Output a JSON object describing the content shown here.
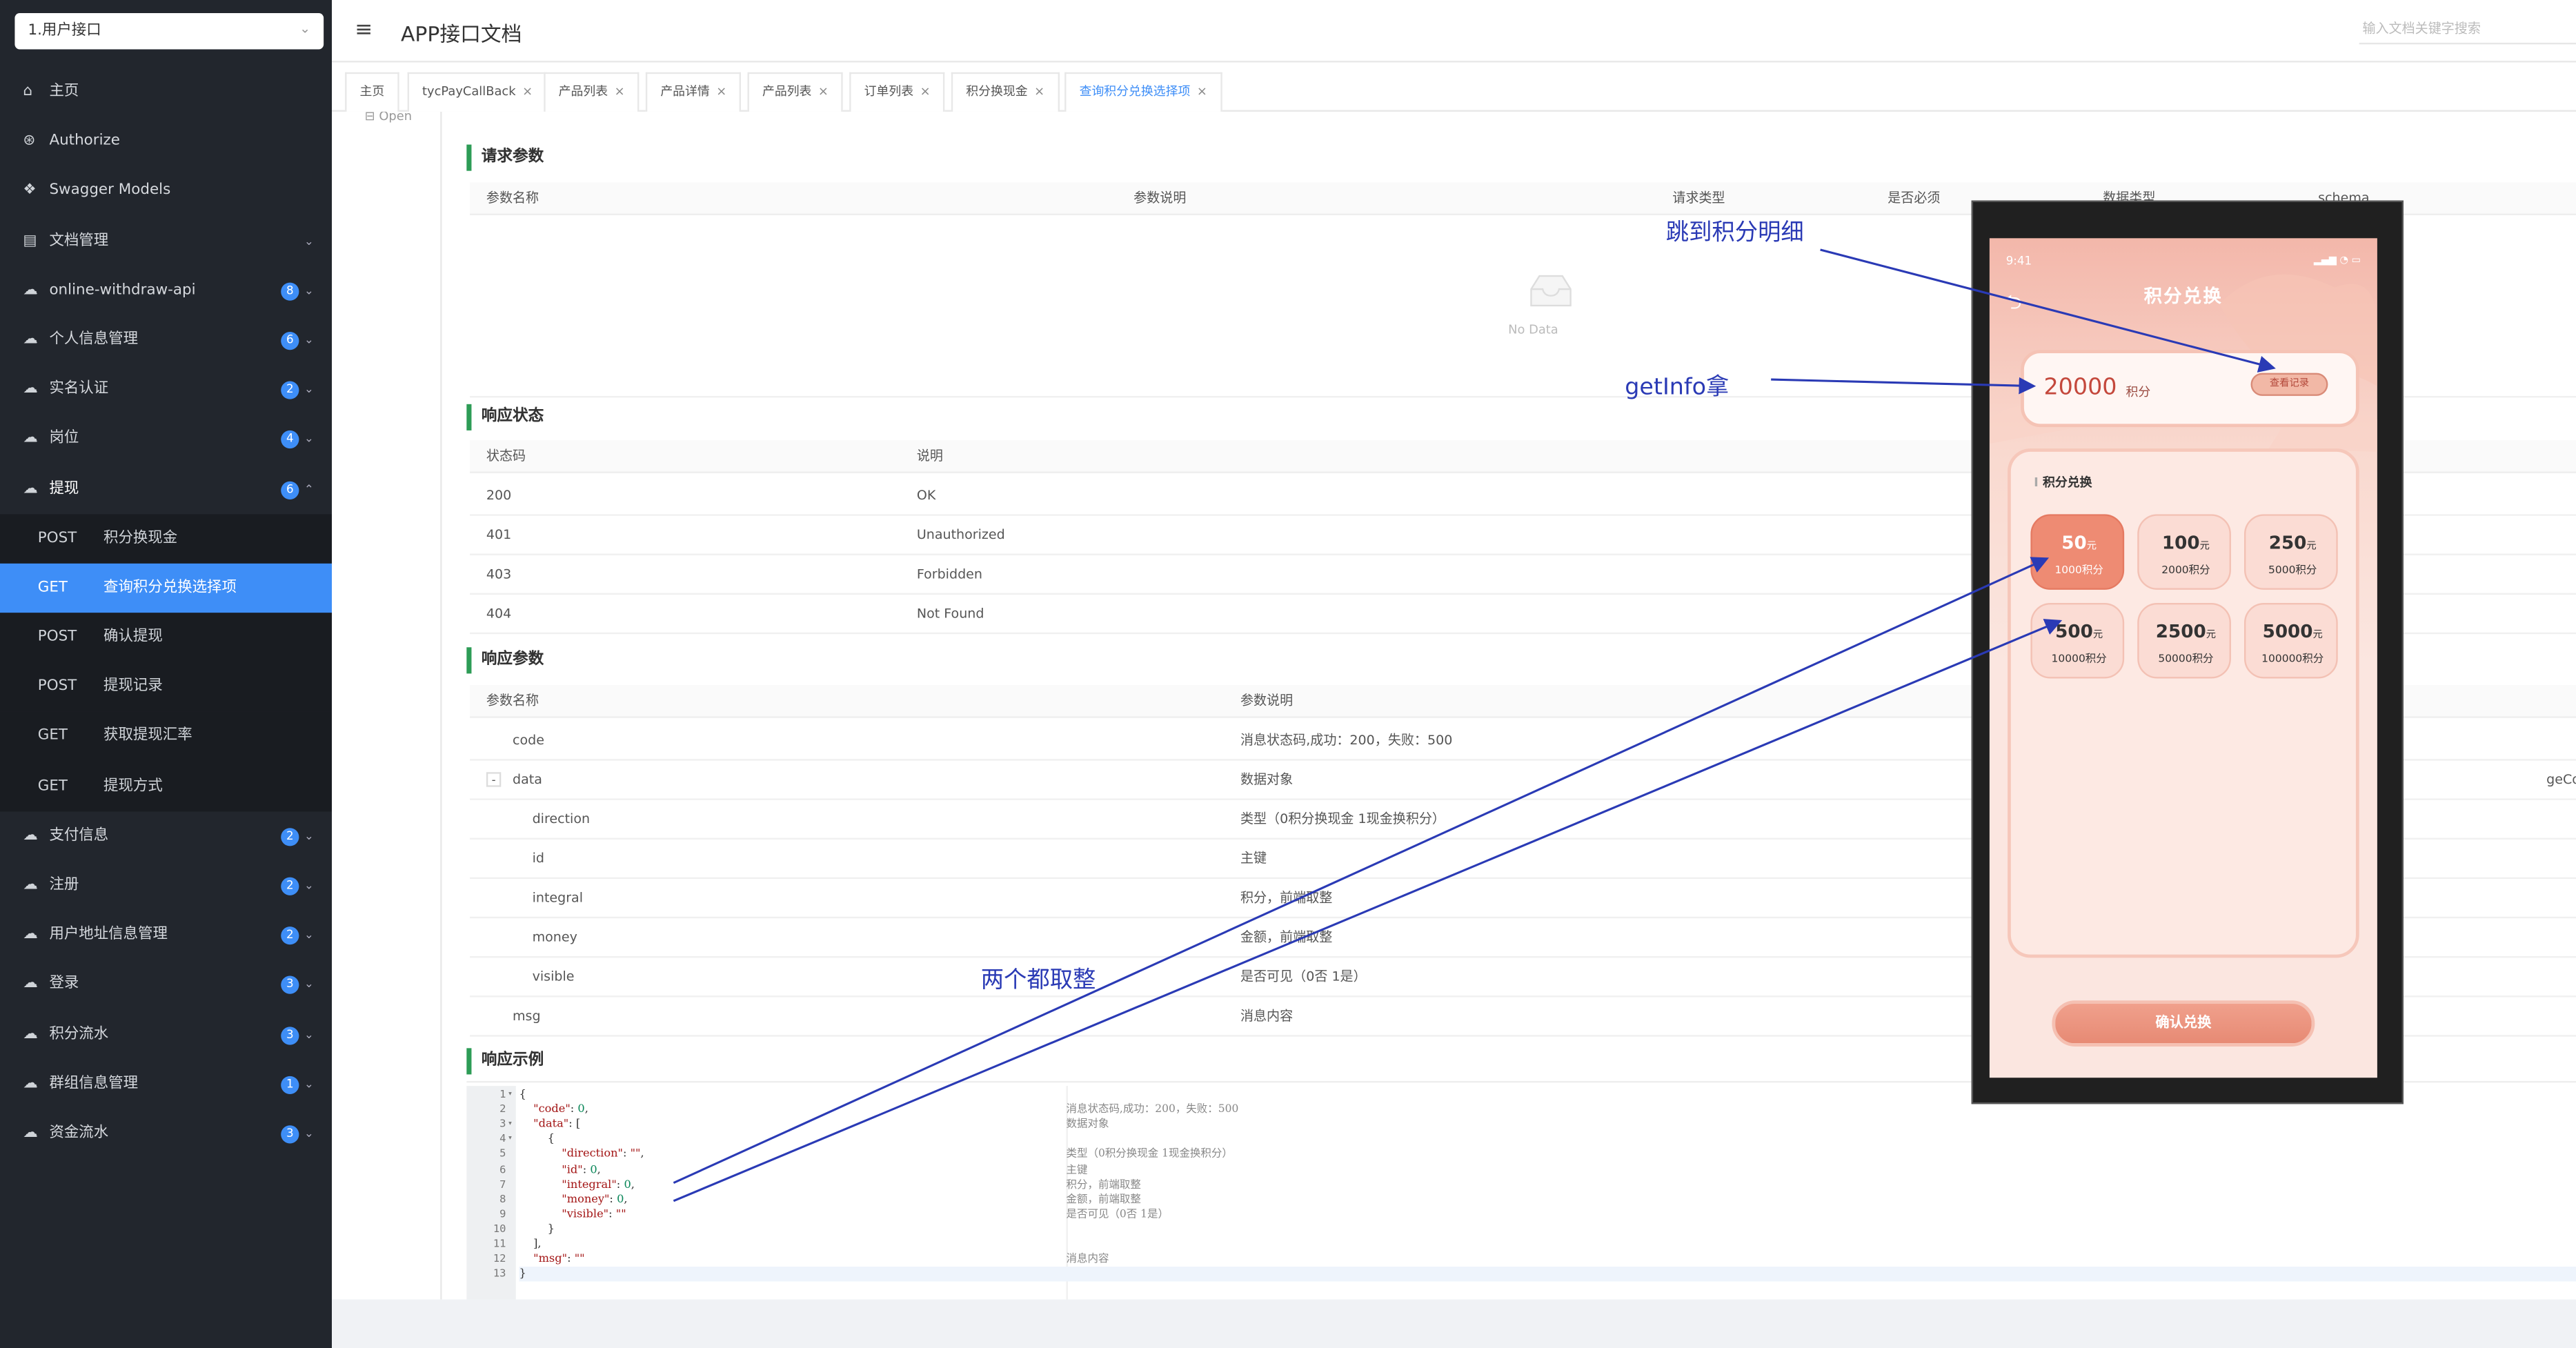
{
  "sidebar": {
    "group_select": "1.用户接口",
    "items": [
      {
        "icon": "home-icon",
        "glyph": "⌂",
        "label": "主页"
      },
      {
        "icon": "lock-icon",
        "glyph": "⊛",
        "label": "Authorize"
      },
      {
        "icon": "models-icon",
        "glyph": "❖",
        "label": "Swagger Models"
      },
      {
        "icon": "document-icon",
        "glyph": "▤",
        "label": "文档管理",
        "arrow": "⌄"
      },
      {
        "icon": "cloud-icon",
        "glyph": "☁",
        "label": "online-withdraw-api",
        "badge": "8",
        "arrow": "⌄"
      },
      {
        "icon": "cloud-icon",
        "glyph": "☁",
        "label": "个人信息管理",
        "badge": "6",
        "arrow": "⌄"
      },
      {
        "icon": "cloud-icon",
        "glyph": "☁",
        "label": "实名认证",
        "badge": "2",
        "arrow": "⌄"
      },
      {
        "icon": "cloud-icon",
        "glyph": "☁",
        "label": "岗位",
        "badge": "4",
        "arrow": "⌄"
      },
      {
        "icon": "cloud-icon",
        "glyph": "☁",
        "label": "提现",
        "badge": "6",
        "arrow": "⌃"
      }
    ],
    "sub_items": [
      {
        "method": "POST",
        "label": "积分换现金"
      },
      {
        "method": "GET",
        "label": "查询积分兑换选择项"
      },
      {
        "method": "POST",
        "label": "确认提现"
      },
      {
        "method": "POST",
        "label": "提现记录"
      },
      {
        "method": "GET",
        "label": "获取提现汇率"
      },
      {
        "method": "GET",
        "label": "提现方式"
      }
    ],
    "items_after": [
      {
        "icon": "cloud-icon",
        "glyph": "☁",
        "label": "支付信息",
        "badge": "2",
        "arrow": "⌄"
      },
      {
        "icon": "cloud-icon",
        "glyph": "☁",
        "label": "注册",
        "badge": "2",
        "arrow": "⌄"
      },
      {
        "icon": "cloud-icon",
        "glyph": "☁",
        "label": "用户地址信息管理",
        "badge": "2",
        "arrow": "⌄"
      },
      {
        "icon": "cloud-icon",
        "glyph": "☁",
        "label": "登录",
        "badge": "3",
        "arrow": "⌄"
      },
      {
        "icon": "cloud-icon",
        "glyph": "☁",
        "label": "积分流水",
        "badge": "3",
        "arrow": "⌄"
      },
      {
        "icon": "cloud-icon",
        "glyph": "☁",
        "label": "群组信息管理",
        "badge": "1",
        "arrow": "⌄"
      },
      {
        "icon": "cloud-icon",
        "glyph": "☁",
        "label": "资金流水",
        "badge": "3",
        "arrow": "⌄"
      }
    ]
  },
  "header": {
    "menu_icon": "≡",
    "title": "APP接口文档",
    "search_placeholder": "输入文档关键字搜索"
  },
  "tabs": [
    {
      "label": "主页",
      "closable": false
    },
    {
      "label": "tycPayCallBack",
      "closable": true
    },
    {
      "label": "产品列表",
      "closable": true
    },
    {
      "label": "产品详情",
      "closable": true
    },
    {
      "label": "产品列表",
      "closable": true
    },
    {
      "label": "订单列表",
      "closable": true
    },
    {
      "label": "积分换现金",
      "closable": true
    },
    {
      "label": "查询积分兑换选择项",
      "closable": true,
      "active": true
    }
  ],
  "content": {
    "open_label": "Open",
    "request_params": {
      "title": "请求参数",
      "headers": [
        "参数名称",
        "参数说明",
        "请求类型",
        "是否必须",
        "数据类型",
        "schema"
      ],
      "empty_text": "No Data"
    },
    "response_status": {
      "title": "响应状态",
      "headers": [
        "状态码",
        "说明"
      ],
      "rows": [
        {
          "code": "200",
          "desc": "OK"
        },
        {
          "code": "401",
          "desc": "Unauthorized"
        },
        {
          "code": "403",
          "desc": "Forbidden"
        },
        {
          "code": "404",
          "desc": "Not Found"
        }
      ]
    },
    "response_params": {
      "title": "响应参数",
      "headers": [
        "参数名称",
        "参数说明"
      ],
      "rows": [
        {
          "name": "code",
          "desc": "消息状态码,成功：200，失败：500",
          "level": 1
        },
        {
          "name": "data",
          "desc": "数据对象",
          "level": 1,
          "toggle": "-",
          "extra": "geConfig"
        },
        {
          "name": "direction",
          "desc": "类型（0积分换现金 1现金换积分）",
          "level": 2
        },
        {
          "name": "id",
          "desc": "主键",
          "level": 2
        },
        {
          "name": "integral",
          "desc": "积分，前端取整",
          "level": 2
        },
        {
          "name": "money",
          "desc": "金额，前端取整",
          "level": 2
        },
        {
          "name": "visible",
          "desc": "是否可见（0否 1是）",
          "level": 2
        },
        {
          "name": "msg",
          "desc": "消息内容",
          "level": 1
        }
      ]
    },
    "response_example": {
      "title": "响应示例",
      "lines": [
        {
          "n": "1",
          "fold": "▾",
          "code": "{",
          "desc": ""
        },
        {
          "n": "2",
          "code": "    \"code\": 0,",
          "desc": "消息状态码,成功：200，失败：500"
        },
        {
          "n": "3",
          "fold": "▾",
          "code": "    \"data\": [",
          "desc": "数据对象"
        },
        {
          "n": "4",
          "fold": "▾",
          "code": "        {",
          "desc": ""
        },
        {
          "n": "5",
          "code": "            \"direction\": \"\",",
          "desc": "类型（0积分换现金 1现金换积分）"
        },
        {
          "n": "6",
          "code": "            \"id\": 0,",
          "desc": "主键"
        },
        {
          "n": "7",
          "code": "            \"integral\": 0,",
          "desc": "积分，前端取整"
        },
        {
          "n": "8",
          "code": "            \"money\": 0,",
          "desc": "金额，前端取整"
        },
        {
          "n": "9",
          "code": "            \"visible\": \"\"",
          "desc": "是否可见（0否 1是）"
        },
        {
          "n": "10",
          "code": "        }",
          "desc": ""
        },
        {
          "n": "11",
          "code": "    ],",
          "desc": ""
        },
        {
          "n": "12",
          "code": "    \"msg\": \"\"",
          "desc": "消息内容"
        },
        {
          "n": "13",
          "code": "}",
          "desc": "",
          "highlight": true
        }
      ]
    }
  },
  "phone": {
    "time": "9:41",
    "status_icons": "▂▄▆ ◔ ▭",
    "back_icon": "⮌",
    "title": "积分兑换",
    "points_value": "20000",
    "points_unit": "积分",
    "record_button": "查看记录",
    "exchange_title": "积分兑换",
    "currency_unit": "元",
    "options": [
      {
        "value": "50",
        "points": "1000积分",
        "selected": true
      },
      {
        "value": "100",
        "points": "2000积分"
      },
      {
        "value": "250",
        "points": "5000积分"
      },
      {
        "value": "500",
        "points": "10000积分"
      },
      {
        "value": "2500",
        "points": "50000积分"
      },
      {
        "value": "5000",
        "points": "100000积分"
      }
    ],
    "confirm_button": "确认兑换"
  },
  "annotations": {
    "jump_detail": "跳到积分明细",
    "get_info": "getInfo拿",
    "both_rounded": "两个都取整",
    "color": "#2a3ab5"
  }
}
